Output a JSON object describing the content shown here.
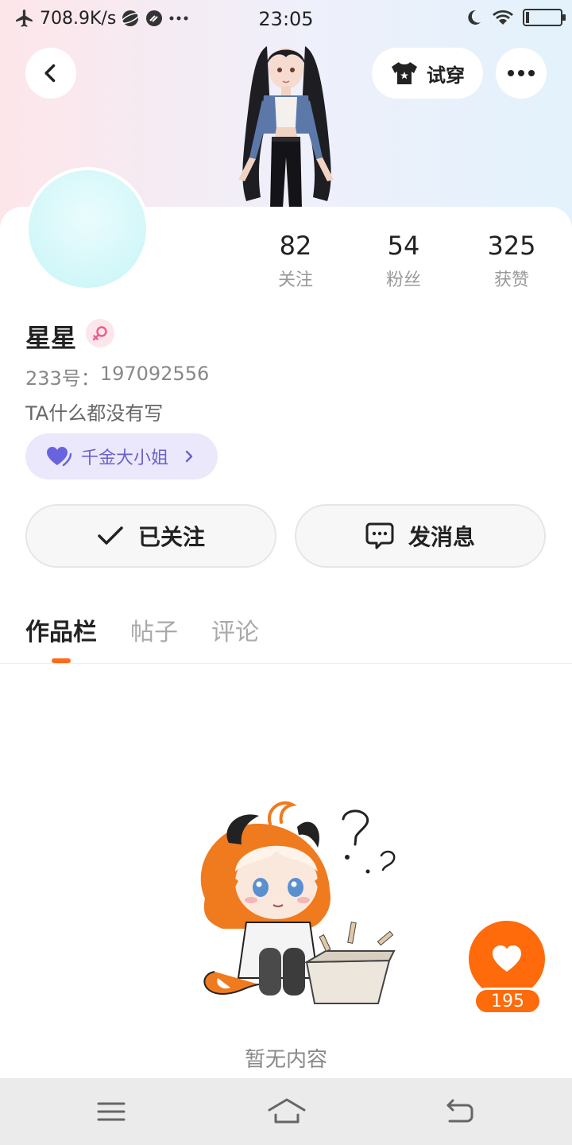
{
  "status_bar": {
    "network_speed": "708.9K/s",
    "time": "23:05"
  },
  "header": {
    "back_icon": "chevron-left-icon",
    "try_on_label": "试穿",
    "more_icon": "more-dots-icon"
  },
  "profile": {
    "stats": [
      {
        "value": "82",
        "label": "关注"
      },
      {
        "value": "54",
        "label": "粉丝"
      },
      {
        "value": "325",
        "label": "获赞"
      }
    ],
    "username": "星星",
    "gender_icon": "female-icon",
    "uid_label": "233号：",
    "uid_value": "197092556",
    "bio": "TA什么都没有写",
    "title_badge": "千金大小姐"
  },
  "actions": {
    "follow_label": "已关注",
    "message_label": "发消息"
  },
  "tabs": [
    {
      "label": "作品栏",
      "active": true
    },
    {
      "label": "帖子",
      "active": false
    },
    {
      "label": "评论",
      "active": false
    }
  ],
  "empty_state": {
    "text": "暂无内容"
  },
  "like_button": {
    "count": "195"
  },
  "colors": {
    "accent": "#ff6a0a",
    "badge_text": "#6a63c9",
    "badge_bg": "#ebe8fb"
  }
}
